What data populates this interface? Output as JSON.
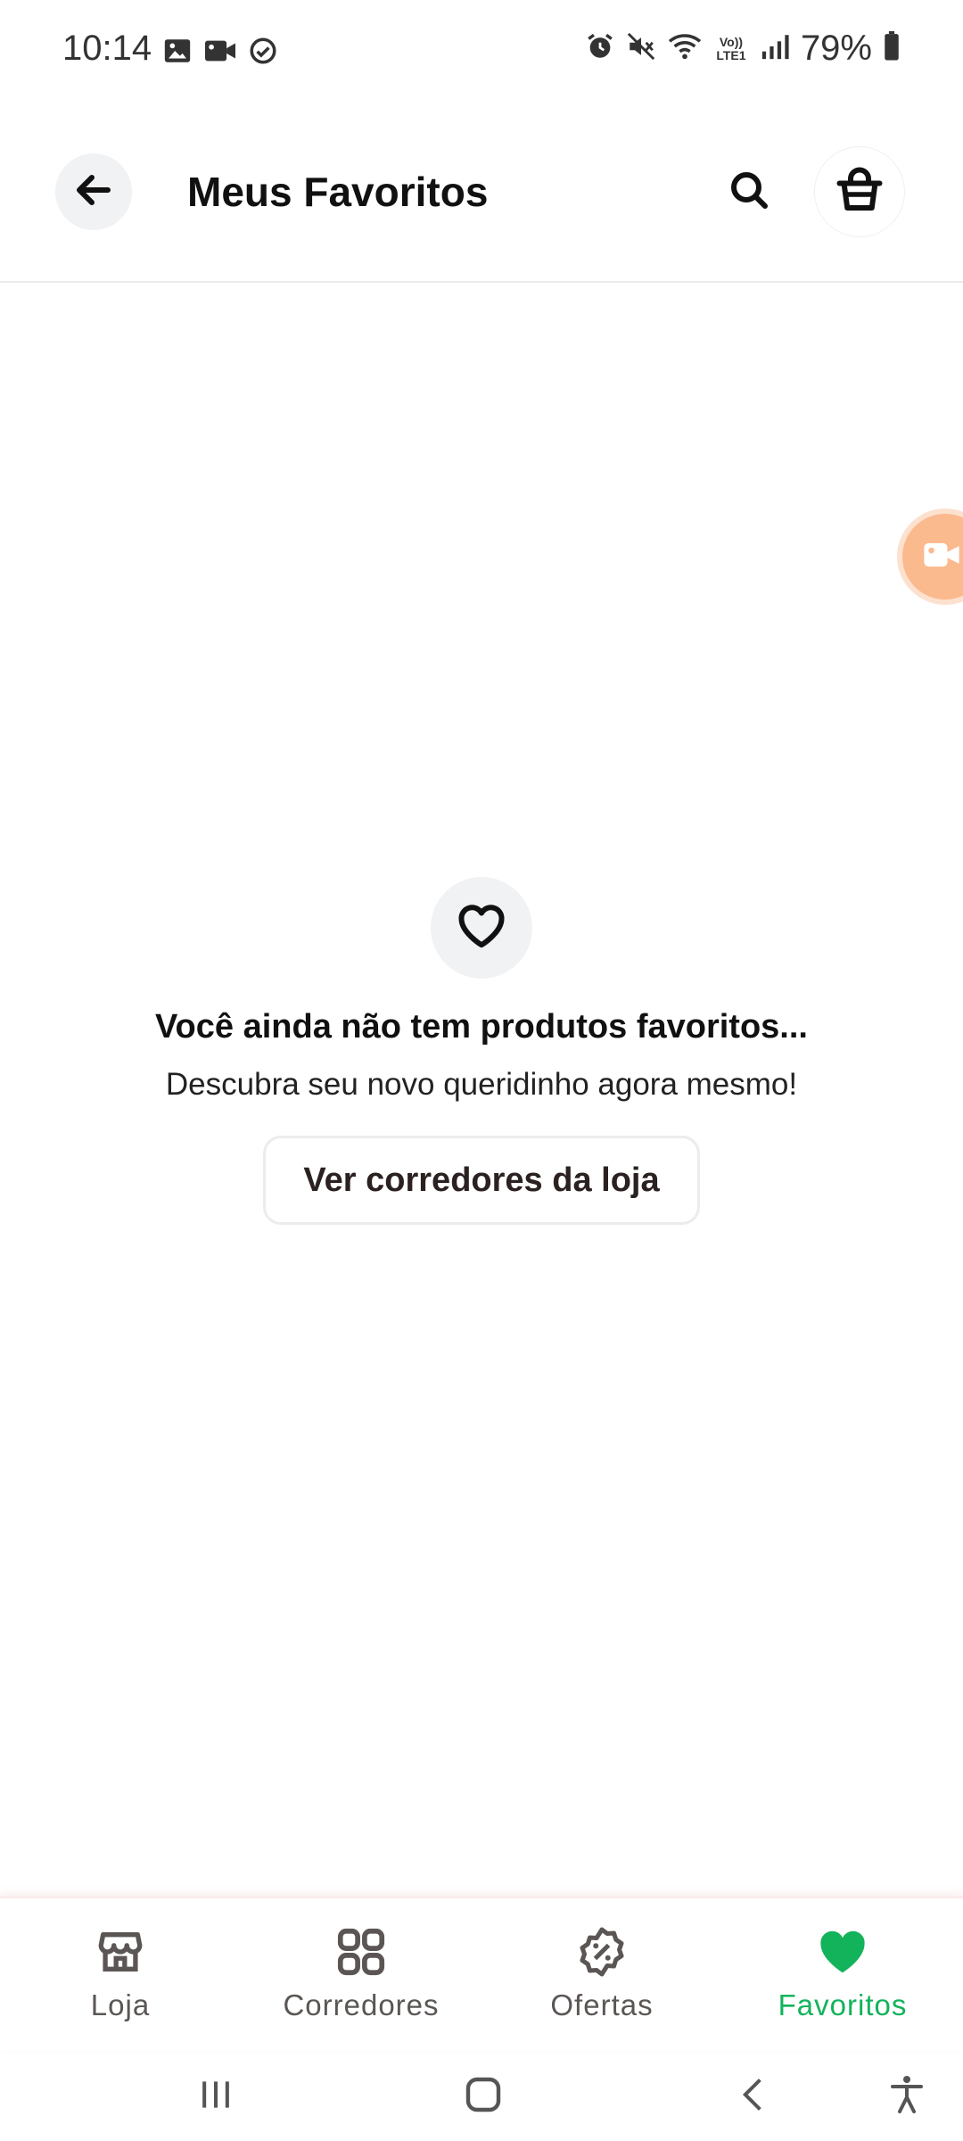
{
  "status_bar": {
    "time": "10:14",
    "battery": "79%",
    "left_icons": [
      "image-icon",
      "video-icon",
      "check-circle-icon"
    ],
    "right_icons": [
      "alarm-icon",
      "mute-icon",
      "wifi-icon",
      "volte-icon",
      "signal-icon",
      "battery-icon"
    ],
    "volte_label": "Vo)) LTE1"
  },
  "header": {
    "title": "Meus Favoritos"
  },
  "empty_state": {
    "title": "Você ainda não tem produtos favoritos...",
    "subtitle": "Descubra seu novo queridinho agora mesmo!",
    "cta_label": "Ver corredores da loja"
  },
  "bottom_nav": {
    "items": [
      {
        "label": "Loja",
        "icon": "store-icon",
        "active": false
      },
      {
        "label": "Corredores",
        "icon": "grid-icon",
        "active": false
      },
      {
        "label": "Ofertas",
        "icon": "discount-badge-icon",
        "active": false
      },
      {
        "label": "Favoritos",
        "icon": "heart-icon",
        "active": true
      }
    ]
  },
  "colors": {
    "accent_active": "#13b35b",
    "float_button": "#fbb98e",
    "icon_muted": "#5b5654"
  }
}
